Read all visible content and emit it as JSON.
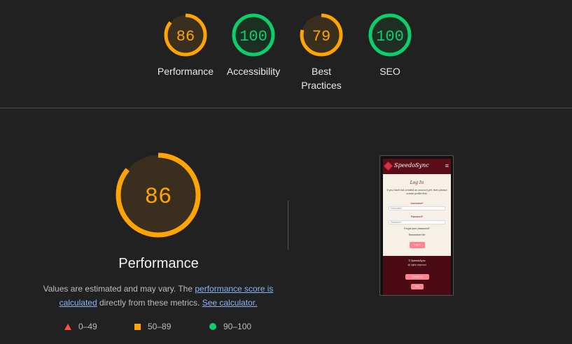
{
  "categories": [
    {
      "key": "performance",
      "score": 86,
      "label": "Performance",
      "color": "#ffa400",
      "fill": "#3a2f1f"
    },
    {
      "key": "accessibility",
      "score": 100,
      "label": "Accessibility",
      "color": "#0cce6b",
      "fill": "#1d2e22"
    },
    {
      "key": "best_practices",
      "score": 79,
      "label": "Best Practices",
      "color": "#ffa400",
      "fill": "#3a2f1f"
    },
    {
      "key": "seo",
      "score": 100,
      "label": "SEO",
      "color": "#0cce6b",
      "fill": "#1d2e22"
    }
  ],
  "main": {
    "score": 86,
    "title": "Performance",
    "desc_before": "Values are estimated and may vary. The ",
    "link_score": "performance score is calculated",
    "desc_middle": " directly from these metrics. ",
    "link_calc": "See calculator."
  },
  "legend": {
    "fail": "0–49",
    "average": "50–89",
    "pass": "90–100"
  },
  "preview": {
    "logo": "SpeedoSync",
    "heading": "Log In",
    "intro": "If you have not created an account yet, then please create profile first.",
    "username_label": "Username*",
    "username_placeholder": "Username",
    "password_label": "Password*",
    "password_placeholder": "Password",
    "forgot": "Forgot your password?",
    "remember": "Remember Me",
    "login_btn": "Log In",
    "footer_copy": "© SpeedoSync",
    "footer_rights": "All rights reserved",
    "contact_btn": "Contact us",
    "faq_btn": "FAQ"
  }
}
